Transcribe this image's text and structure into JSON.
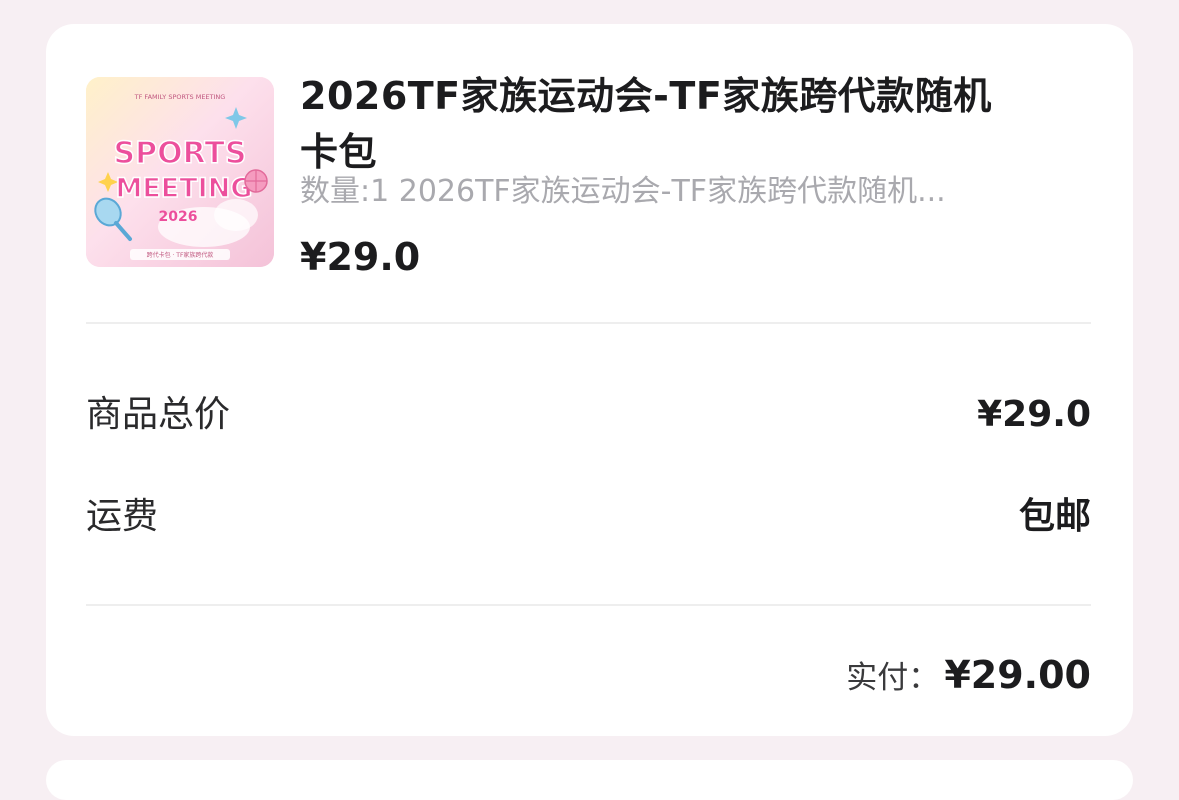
{
  "product": {
    "title": "2026TF家族运动会-TF家族跨代款随机卡包",
    "subtitle": "数量:1 2026TF家族运动会-TF家族跨代款随机...",
    "price": "¥29.0",
    "image": {
      "icon": "product-thumbnail",
      "top_text": "TF FAMILY SPORTS MEETING",
      "line1": "SPORTS",
      "line2": "MEETING",
      "year": "2026",
      "caption": "跨代卡包 · TF家族跨代款"
    }
  },
  "summary": {
    "goods_total_label": "商品总价",
    "goods_total_value": "¥29.0",
    "shipping_label": "运费",
    "shipping_value": "包邮",
    "paid_label": "实付：",
    "paid_value": "¥29.00"
  },
  "colors": {
    "page_background": "#f7eff3",
    "card_background": "#ffffff",
    "text_primary": "#1c1c1e",
    "text_secondary": "#a9a9ae",
    "accent_pink": "#ec4f9c"
  }
}
